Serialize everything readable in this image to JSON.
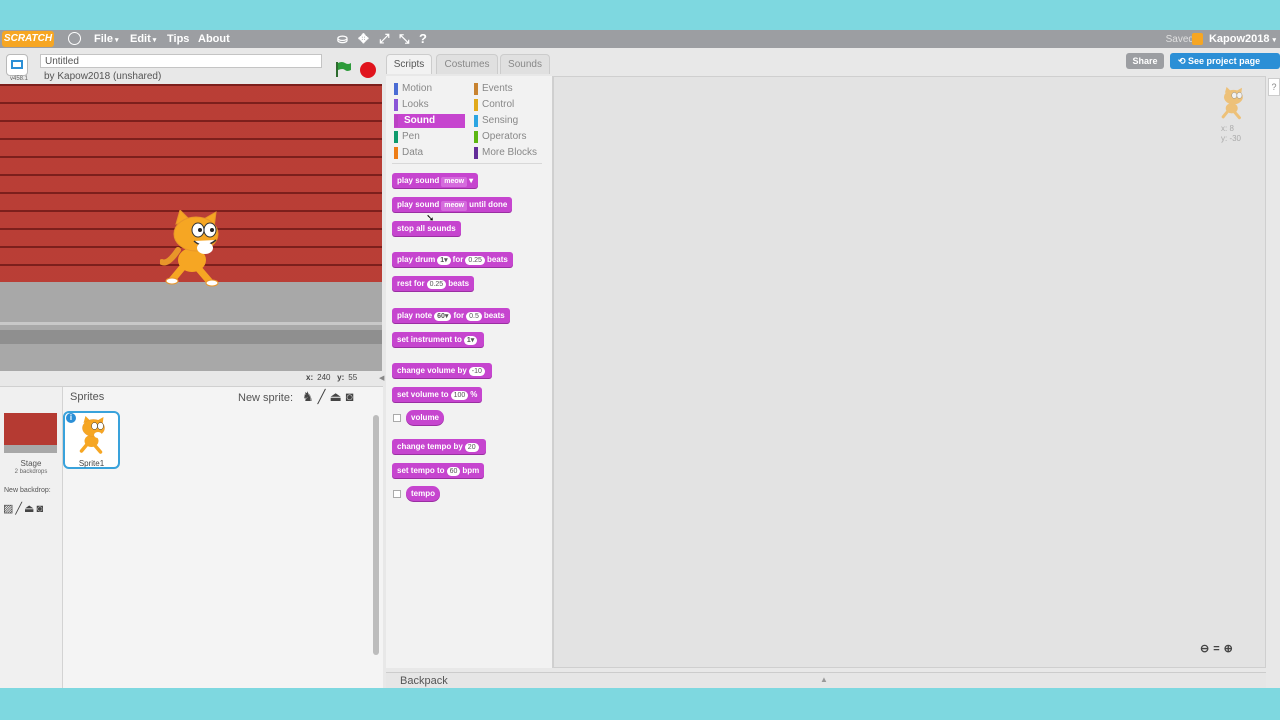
{
  "menubar": {
    "logo": "SCRATCH",
    "items": [
      {
        "label": "File",
        "has_caret": true
      },
      {
        "label": "Edit",
        "has_caret": true
      },
      {
        "label": "Tips",
        "has_caret": false
      },
      {
        "label": "About",
        "has_caret": false
      }
    ],
    "tool_icons": [
      "duplicate-icon",
      "delete-icon",
      "grow-icon",
      "shrink-icon",
      "help-icon"
    ],
    "saved_label": "Saved",
    "username": "Kapow2018",
    "caret": "▾"
  },
  "stage_header": {
    "version": "v458.1",
    "project_title": "Untitled",
    "byline": "by Kapow2018 (unshared)"
  },
  "stage": {
    "mouse_x_label": "x:",
    "mouse_x": "240",
    "mouse_y_label": "y:",
    "mouse_y": "55"
  },
  "sprites_pane": {
    "title": "Sprites",
    "new_sprite_label": "New sprite:",
    "stage_label": "Stage",
    "backdrops_count": "2 backdrops",
    "new_backdrop_label": "New backdrop:",
    "sprites": [
      {
        "name": "Sprite1"
      }
    ]
  },
  "tabs": [
    {
      "label": "Scripts",
      "active": true
    },
    {
      "label": "Costumes",
      "active": false
    },
    {
      "label": "Sounds",
      "active": false
    }
  ],
  "categories": [
    {
      "label": "Motion",
      "color": "#4a6cd4"
    },
    {
      "label": "Events",
      "color": "#c88330"
    },
    {
      "label": "Looks",
      "color": "#8a55d7"
    },
    {
      "label": "Control",
      "color": "#e1a91a"
    },
    {
      "label": "Sound",
      "color": "#bb42c3",
      "selected": true
    },
    {
      "label": "Sensing",
      "color": "#2ca5e2"
    },
    {
      "label": "Pen",
      "color": "#0e9a6c"
    },
    {
      "label": "Operators",
      "color": "#5cb712"
    },
    {
      "label": "Data",
      "color": "#ee7d16"
    },
    {
      "label": "More Blocks",
      "color": "#632d99"
    }
  ],
  "blocks": {
    "play_sound": {
      "a": "play sound",
      "dd": "meow"
    },
    "play_sound_until": {
      "a": "play sound",
      "dd": "meow",
      "b": "until done"
    },
    "stop_all": {
      "a": "stop all sounds"
    },
    "play_drum": {
      "a": "play drum",
      "dd": "1▾",
      "b": "for",
      "v": "0.25",
      "c": "beats"
    },
    "rest_for": {
      "a": "rest for",
      "v": "0.25",
      "b": "beats"
    },
    "play_note": {
      "a": "play note",
      "dd": "60▾",
      "b": "for",
      "v": "0.5",
      "c": "beats"
    },
    "set_instrument": {
      "a": "set instrument to",
      "dd": "1▾"
    },
    "change_volume": {
      "a": "change volume by",
      "v": "-10"
    },
    "set_volume": {
      "a": "set volume to",
      "v": "100",
      "b": "%"
    },
    "volume": {
      "a": "volume"
    },
    "change_tempo": {
      "a": "change tempo by",
      "v": "20"
    },
    "set_tempo": {
      "a": "set tempo to",
      "v": "60",
      "b": "bpm"
    },
    "tempo": {
      "a": "tempo"
    }
  },
  "header_buttons": {
    "share": "Share",
    "see_project": "See project page"
  },
  "script_area": {
    "sprite_x": "x: 8",
    "sprite_y": "y: -30"
  },
  "backpack": {
    "label": "Backpack"
  },
  "colors": {
    "sound_block": "#c645cf",
    "accent_blue": "#2b8fd6",
    "stop_red": "#e0141d",
    "flag_green": "#2d9b3a",
    "brick_red": "#b53a32"
  }
}
